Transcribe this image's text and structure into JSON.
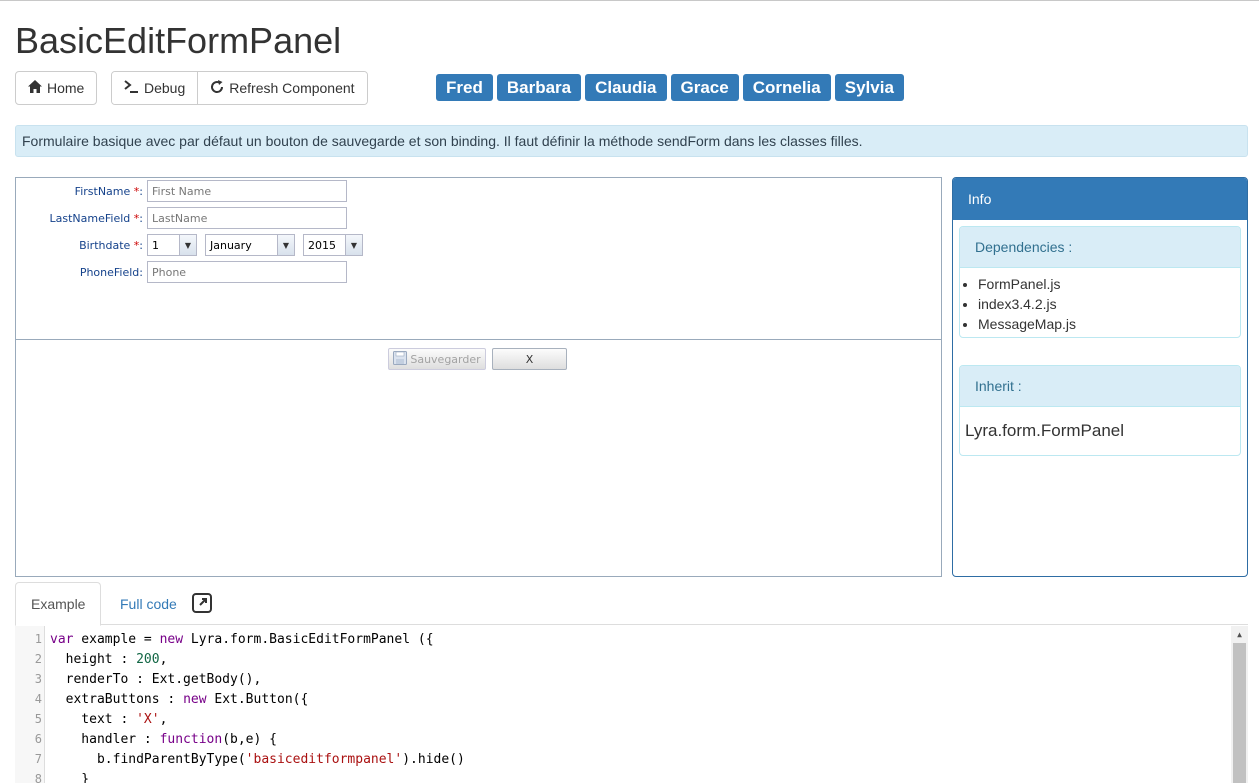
{
  "page": {
    "title": "BasicEditFormPanel"
  },
  "toolbar": {
    "home_label": "Home",
    "debug_label": "Debug",
    "refresh_label": "Refresh Component",
    "name_tabs": [
      "Fred",
      "Barbara",
      "Claudia",
      "Grace",
      "Cornelia",
      "Sylvia"
    ]
  },
  "alert": {
    "text": "Formulaire basique avec par défaut un bouton de sauvegarde et son binding. Il faut définir la méthode sendForm dans les classes filles."
  },
  "form": {
    "fields": [
      {
        "label": "FirstName",
        "required": "*",
        "placeholder": "First Name"
      },
      {
        "label": "LastNameField",
        "required": "*",
        "placeholder": "LastName"
      },
      {
        "label": "Birthdate",
        "required": "*"
      },
      {
        "label": "PhoneField",
        "required": "",
        "placeholder": "Phone"
      }
    ],
    "birthdate": {
      "day": "1",
      "month": "January",
      "year": "2015"
    },
    "save_label": "Sauvegarder",
    "close_label": "X"
  },
  "info": {
    "title": "Info",
    "dependencies_title": "Dependencies :",
    "dependencies": [
      "FormPanel.js",
      "index3.4.2.js",
      "MessageMap.js"
    ],
    "inherit_title": "Inherit :",
    "inherit_value": "Lyra.form.FormPanel"
  },
  "tabs": {
    "example": "Example",
    "full_code": "Full code"
  },
  "code": {
    "line_numbers": [
      "1",
      "2",
      "3",
      "4",
      "5",
      "6",
      "7",
      "8"
    ],
    "lines": {
      "l1a": "var",
      "l1b": " example = ",
      "l1c": "new",
      "l1d": " Lyra.form.BasicEditFormPanel ({",
      "l2a": "  height : ",
      "l2b": "200",
      "l2c": ",",
      "l3": "  renderTo : Ext.getBody(),",
      "l4a": "  extraButtons : ",
      "l4b": "new",
      "l4c": " Ext.Button({",
      "l5a": "    text : ",
      "l5b": "'X'",
      "l5c": ",",
      "l6a": "    handler : ",
      "l6b": "function",
      "l6c": "(b,e) {",
      "l7a": "      b.findParentByType(",
      "l7b": "'basiceditformpanel'",
      "l7c": ").hide()",
      "l8": "    }"
    }
  }
}
